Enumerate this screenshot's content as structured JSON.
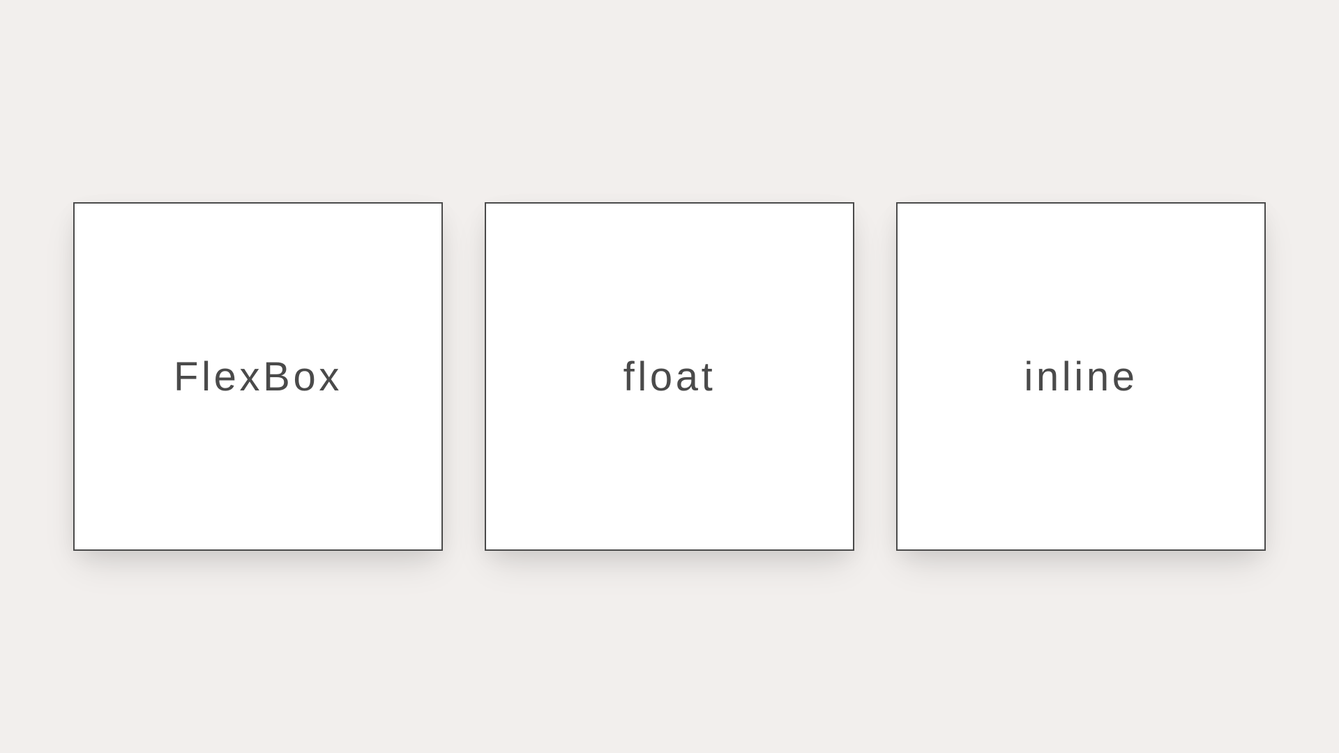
{
  "cards": [
    {
      "label": "FlexBox"
    },
    {
      "label": "float"
    },
    {
      "label": "inline"
    }
  ]
}
